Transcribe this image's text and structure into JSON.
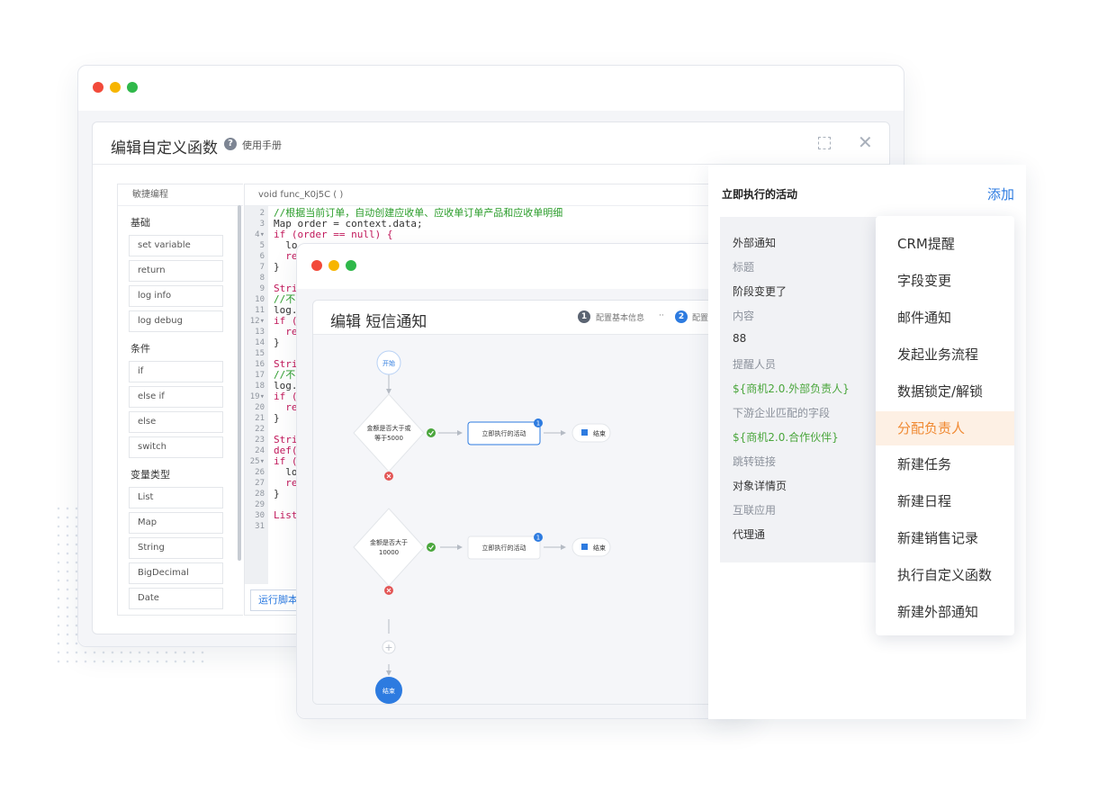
{
  "function_editor": {
    "title": "编辑自定义函数",
    "help_icon": "help-circle-icon",
    "help_label": "使用手册",
    "sidebar_title": "敏捷编程",
    "sections": [
      {
        "label": "基础",
        "blocks": [
          "set variable",
          "return",
          "log info",
          "log debug"
        ]
      },
      {
        "label": "条件",
        "blocks": [
          "if",
          "else if",
          "else",
          "switch"
        ]
      },
      {
        "label": "变量类型",
        "blocks": [
          "List",
          "Map",
          "String",
          "BigDecimal",
          "Date"
        ]
      }
    ],
    "code_signature": "void func_K0j5C ( )",
    "code_lines": [
      {
        "n": "2",
        "text": "//根据当前订单，自动创建应收单、应收单订单产品和应收单明细",
        "color": "#2a9c2a"
      },
      {
        "n": "3",
        "text": "Map order = context.data;",
        "color": "#333333"
      },
      {
        "n": "4▾",
        "text": "if (order == null) {",
        "color": "#c2185b"
      },
      {
        "n": "5",
        "text": "  lo",
        "color": "#333333"
      },
      {
        "n": "6",
        "text": "  re",
        "color": "#c2185b"
      },
      {
        "n": "7",
        "text": "}",
        "color": "#333333"
      },
      {
        "n": "8",
        "text": "",
        "color": "#333333"
      },
      {
        "n": "9",
        "text": "Stri",
        "color": "#c2185b"
      },
      {
        "n": "10",
        "text": "//不",
        "color": "#2a9c2a"
      },
      {
        "n": "11",
        "text": "log.",
        "color": "#333333"
      },
      {
        "n": "12▾",
        "text": "if (",
        "color": "#c2185b"
      },
      {
        "n": "13",
        "text": "  re",
        "color": "#c2185b"
      },
      {
        "n": "14",
        "text": "}",
        "color": "#333333"
      },
      {
        "n": "15",
        "text": "",
        "color": "#333333"
      },
      {
        "n": "16",
        "text": "Stri",
        "color": "#c2185b"
      },
      {
        "n": "17",
        "text": "//不",
        "color": "#2a9c2a"
      },
      {
        "n": "18",
        "text": "log.",
        "color": "#333333"
      },
      {
        "n": "19▾",
        "text": "if (",
        "color": "#c2185b"
      },
      {
        "n": "20",
        "text": "  re",
        "color": "#c2185b"
      },
      {
        "n": "21",
        "text": "}",
        "color": "#333333"
      },
      {
        "n": "22",
        "text": "",
        "color": "#333333"
      },
      {
        "n": "23",
        "text": "Stri",
        "color": "#c2185b"
      },
      {
        "n": "24",
        "text": "def(",
        "color": "#c2185b"
      },
      {
        "n": "25▾",
        "text": "if (",
        "color": "#c2185b"
      },
      {
        "n": "26",
        "text": "  lo",
        "color": "#333333"
      },
      {
        "n": "27",
        "text": "  re",
        "color": "#c2185b"
      },
      {
        "n": "28",
        "text": "}",
        "color": "#333333"
      },
      {
        "n": "29",
        "text": "",
        "color": "#333333"
      },
      {
        "n": "30",
        "text": "List",
        "color": "#c2185b"
      },
      {
        "n": "31",
        "text": "",
        "color": "#333333"
      }
    ],
    "run_button": "运行脚本"
  },
  "sms_editor": {
    "title": "编辑 短信通知",
    "step1_num": "1",
    "step1_label": "配置基本信息",
    "step_sep": "··",
    "step2_num": "2",
    "step2_label": "配置",
    "flow": {
      "start": "开始",
      "cond1": [
        "金额是否大于或",
        "等于5000"
      ],
      "cond2": [
        "金额是否大于",
        "10000"
      ],
      "activity": "立即执行的活动",
      "badge": "1",
      "end_small": "结束",
      "end": "结束",
      "add": "+"
    }
  },
  "right_panel": {
    "title": "立即执行的活动",
    "add_label": "添加",
    "form": [
      {
        "text": "外部通知",
        "kind": "val"
      },
      {
        "text": "标题",
        "kind": "lbl"
      },
      {
        "text": "阶段变更了",
        "kind": "val"
      },
      {
        "text": "内容",
        "kind": "lbl"
      },
      {
        "text": "88",
        "kind": "val"
      },
      {
        "text": "提醒人员",
        "kind": "lbl"
      },
      {
        "text": "${商机2.0.外部负责人}",
        "kind": "grn"
      },
      {
        "text": "下游企业匹配的字段",
        "kind": "lbl"
      },
      {
        "text": "${商机2.0.合作伙伴}",
        "kind": "grn"
      },
      {
        "text": "跳转链接",
        "kind": "lbl"
      },
      {
        "text": "对象详情页",
        "kind": "val"
      },
      {
        "text": "互联应用",
        "kind": "lbl"
      },
      {
        "text": "代理通",
        "kind": "val"
      }
    ],
    "menu": [
      "CRM提醒",
      "字段变更",
      "邮件通知",
      "发起业务流程",
      "数据锁定/解锁",
      "分配负责人",
      "新建任务",
      "新建日程",
      "新建销售记录",
      "执行自定义函数",
      "新建外部通知"
    ],
    "menu_active": "分配负责人"
  },
  "colors": {
    "accent": "#2d7be0",
    "highlight": "#f08a33",
    "success": "#4aa63c",
    "danger": "#e35656"
  }
}
